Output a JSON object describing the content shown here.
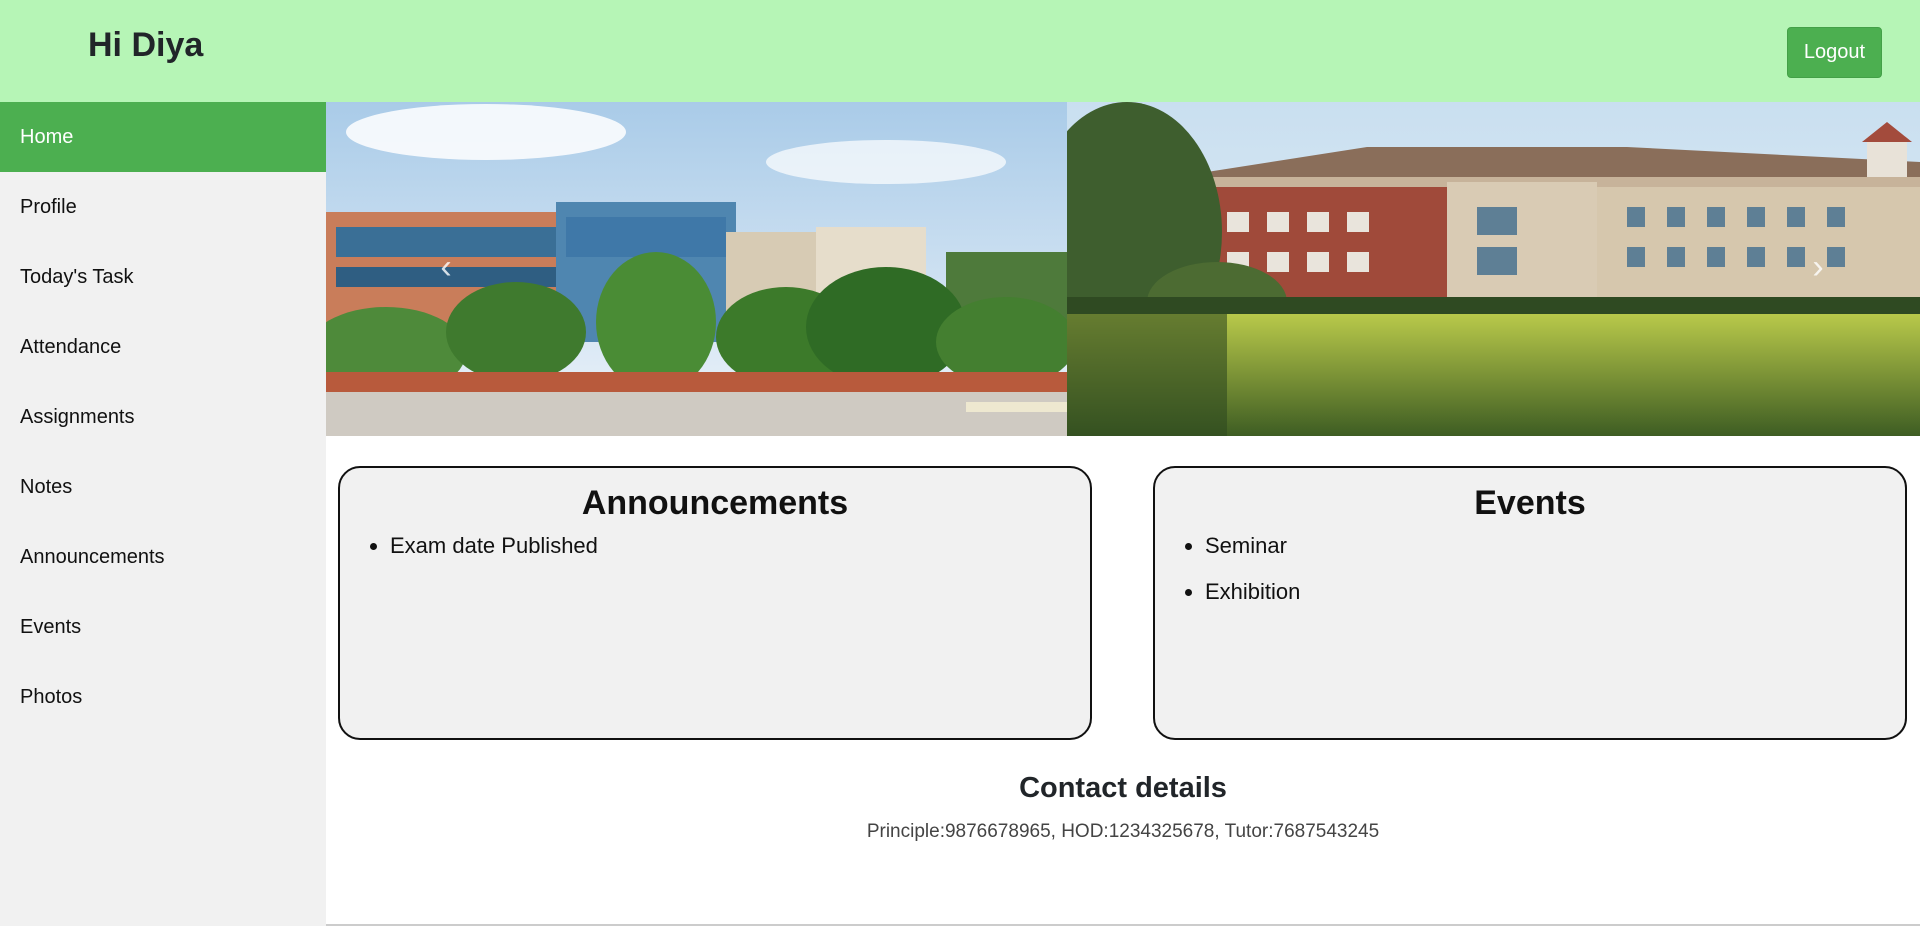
{
  "header": {
    "greeting": "Hi Diya",
    "logout_label": "Logout",
    "background_color": "#b6f5b6",
    "accent_color": "#4caf50"
  },
  "sidebar": {
    "items": [
      {
        "label": "Home",
        "active": true
      },
      {
        "label": "Profile",
        "active": false
      },
      {
        "label": "Today's Task",
        "active": false
      },
      {
        "label": "Attendance",
        "active": false
      },
      {
        "label": "Assignments",
        "active": false
      },
      {
        "label": "Notes",
        "active": false
      },
      {
        "label": "Announcements",
        "active": false
      },
      {
        "label": "Events",
        "active": false
      },
      {
        "label": "Photos",
        "active": false
      }
    ]
  },
  "carousel": {
    "prev_icon": "chevron-left-icon",
    "next_icon": "chevron-right-icon"
  },
  "announcements": {
    "title": "Announcements",
    "items": [
      "Exam date Published"
    ]
  },
  "events": {
    "title": "Events",
    "items": [
      "Seminar",
      "Exhibition"
    ]
  },
  "contact": {
    "title": "Contact details",
    "text": "Principle:9876678965, HOD:1234325678, Tutor:7687543245"
  }
}
